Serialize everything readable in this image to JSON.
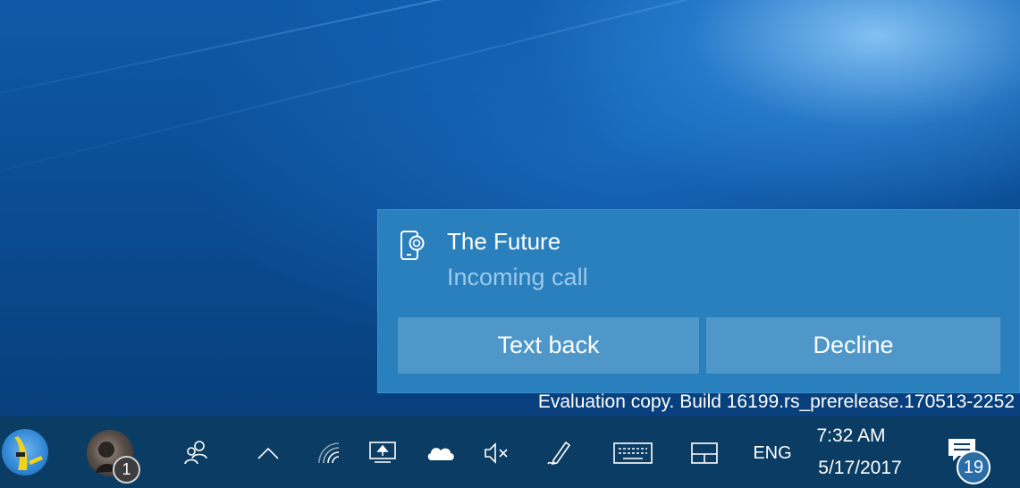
{
  "toast": {
    "title": "The Future",
    "subtitle": "Incoming call",
    "icon": "phone-call-icon",
    "buttons": {
      "text_back": "Text back",
      "decline": "Decline"
    }
  },
  "watermark": "Evaluation copy. Build 16199.rs_prerelease.170513-2252",
  "taskbar": {
    "people_badge_count": "1",
    "language": "ENG",
    "time": "7:32 AM",
    "date": "5/17/2017",
    "notification_count": "19",
    "icons": [
      "contact-avatar",
      "contact-avatar",
      "people-icon",
      "chevron-up-icon",
      "wifi-icon",
      "display-project-icon",
      "onedrive-cloud-icon",
      "volume-muted-icon",
      "pen-ink-icon",
      "keyboard-icon",
      "tablet-icon",
      "action-center-icon"
    ]
  },
  "colors": {
    "toast_bg": "#2a7fbd",
    "toast_button": "#4f97c8",
    "taskbar_bg": "#0b3c63"
  }
}
